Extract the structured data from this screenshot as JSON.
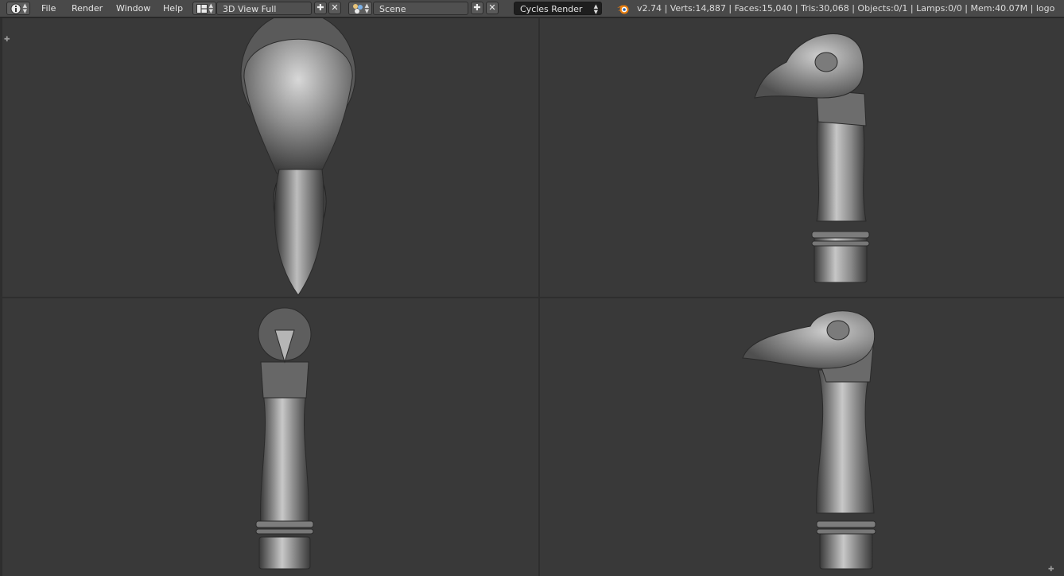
{
  "menu": {
    "file": "File",
    "render": "Render",
    "window": "Window",
    "help": "Help"
  },
  "screen_layout": {
    "value": "3D View Full"
  },
  "scene": {
    "value": "Scene"
  },
  "render_engine": {
    "value": "Cycles Render"
  },
  "status": {
    "text": "v2.74 | Verts:14,887 | Faces:15,040 | Tris:30,068 | Objects:0/1 | Lamps:0/0 | Mem:40.07M | logo"
  },
  "icons": {
    "info": "info-icon",
    "layout": "screen-layout-icon",
    "scene": "scene-icon",
    "blender": "blender-logo-icon",
    "add": "plus-icon",
    "close": "x-icon"
  },
  "colors": {
    "header": "#494949",
    "viewport": "#393939",
    "field": "#1e1e1e",
    "model": "#8a8a8a"
  },
  "viewports": [
    {
      "view": "top"
    },
    {
      "view": "right"
    },
    {
      "view": "front"
    },
    {
      "view": "left"
    }
  ]
}
